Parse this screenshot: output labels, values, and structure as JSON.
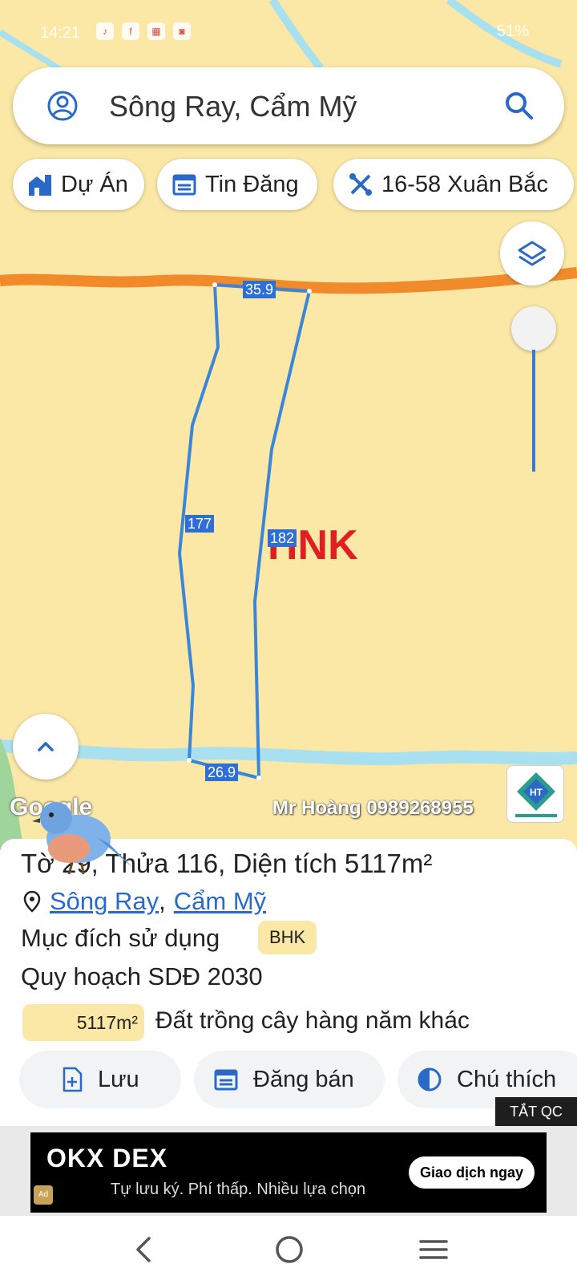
{
  "status_bar": {
    "time": "14:21",
    "battery": "51%"
  },
  "search": {
    "value": "Sông Ray, Cẩm Mỹ"
  },
  "chips": [
    {
      "label": "Dự Án",
      "icon": "building-icon"
    },
    {
      "label": "Tin Đăng",
      "icon": "calendar-icon"
    },
    {
      "label": "16-58 Xuân Bắc",
      "icon": "tools-icon"
    }
  ],
  "map": {
    "dimensions": {
      "top": "35.9",
      "left": "177",
      "right": "182",
      "bottom": "26.9"
    },
    "zone_code": "HNK",
    "google_attribution": "Google",
    "watermark": "Mr Hoàng 0989268955",
    "road_color": "#f08a2a",
    "river_color": "#a9e0f0",
    "parcel_color": "#3a86d8",
    "zone_color": "#e02020"
  },
  "parcel": {
    "title": "Tờ 29, Thửa 116, Diện tích 5117m²",
    "address_parts": [
      "Sông Ray",
      "Cẩm Mỹ"
    ],
    "address_separator": ",",
    "purpose_label": "Mục đích sử dụng",
    "purpose_code": "BHK",
    "plan_label": "Quy hoạch SDĐ 2030",
    "area_value": "5117m²",
    "area_desc": "Đất trồng cây hàng năm khác"
  },
  "actions": [
    {
      "label": "Lưu",
      "icon": "file-plus-icon"
    },
    {
      "label": "Đăng bán",
      "icon": "calendar-icon"
    },
    {
      "label": "Chú thích",
      "icon": "contrast-icon"
    }
  ],
  "ad": {
    "close_label": "TẮT QC",
    "brand": "OKX DEX",
    "tagline": "Tự lưu ký. Phí thấp. Nhiều lựa chọn",
    "cta": "Giao dịch ngay",
    "badge": "Ad"
  }
}
